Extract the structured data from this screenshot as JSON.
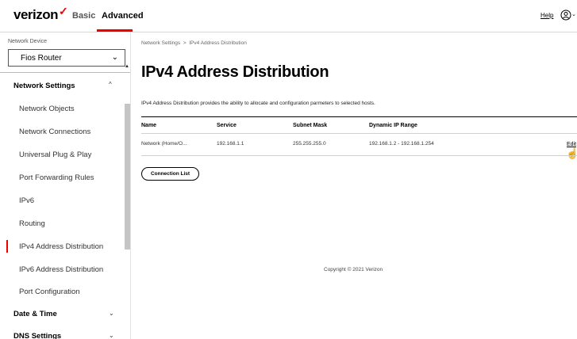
{
  "header": {
    "logo_text": "verizon",
    "logo_mark": "✓",
    "tabs": [
      "Basic",
      "Advanced"
    ],
    "active_tab": "Advanced",
    "help_label": "Help",
    "accent_color": "#ee0000"
  },
  "sidebar": {
    "device_label": "Network Device",
    "device_value": "Fios Router",
    "sections": [
      {
        "label": "Network Settings",
        "expanded": true,
        "items": [
          "Network Objects",
          "Network Connections",
          "Universal Plug & Play",
          "Port Forwarding Rules",
          "IPv6",
          "Routing",
          "IPv4 Address Distribution",
          "IPv6 Address Distribution",
          "Port Configuration"
        ]
      },
      {
        "label": "Date & Time",
        "expanded": false
      },
      {
        "label": "DNS Settings",
        "expanded": false
      }
    ],
    "active_item": "IPv4 Address Distribution"
  },
  "main": {
    "breadcrumb": [
      "Network Settings",
      "IPv4 Address Distribution"
    ],
    "breadcrumb_sep": ">",
    "title": "IPv4 Address Distribution",
    "description": "IPv4 Address Distribution provides the ability to allocate and configuration parmeters to selected hosts.",
    "table": {
      "columns": [
        "Name",
        "Service",
        "Subnet Mask",
        "Dynamic IP Range"
      ],
      "rows": [
        {
          "name": "Network (Home/O...",
          "service": "192.168.1.1",
          "subnet": "255.255.255.0",
          "range": "192.168.1.2 - 192.168.1.254",
          "action": "Edit"
        }
      ]
    },
    "connection_list_button": "Connection List",
    "copyright": "Copyright © 2021 Verizon"
  }
}
